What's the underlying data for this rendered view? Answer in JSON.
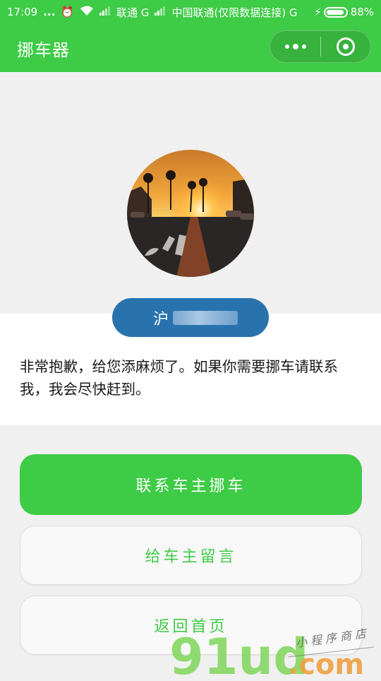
{
  "status_bar": {
    "time": "17:09",
    "dots": "...",
    "carrier1": "联通 G",
    "carrier2": "中国联通(仅限数据连接) G",
    "battery": "88%"
  },
  "nav": {
    "title": "挪车器"
  },
  "plate": {
    "prefix": "沪"
  },
  "message": "非常抱歉，给您添麻烦了。如果你需要挪车请联系我，我会尽快赶到。",
  "buttons": {
    "contact": "联系车主挪车",
    "leave_message": "给车主留言",
    "home": "返回首页"
  },
  "watermark": {
    "brand": "91ud",
    "domain": ".com",
    "tagline": "小程序商店"
  },
  "colors": {
    "brand_green": "#3ecb46",
    "plate_blue": "#2873ad"
  }
}
